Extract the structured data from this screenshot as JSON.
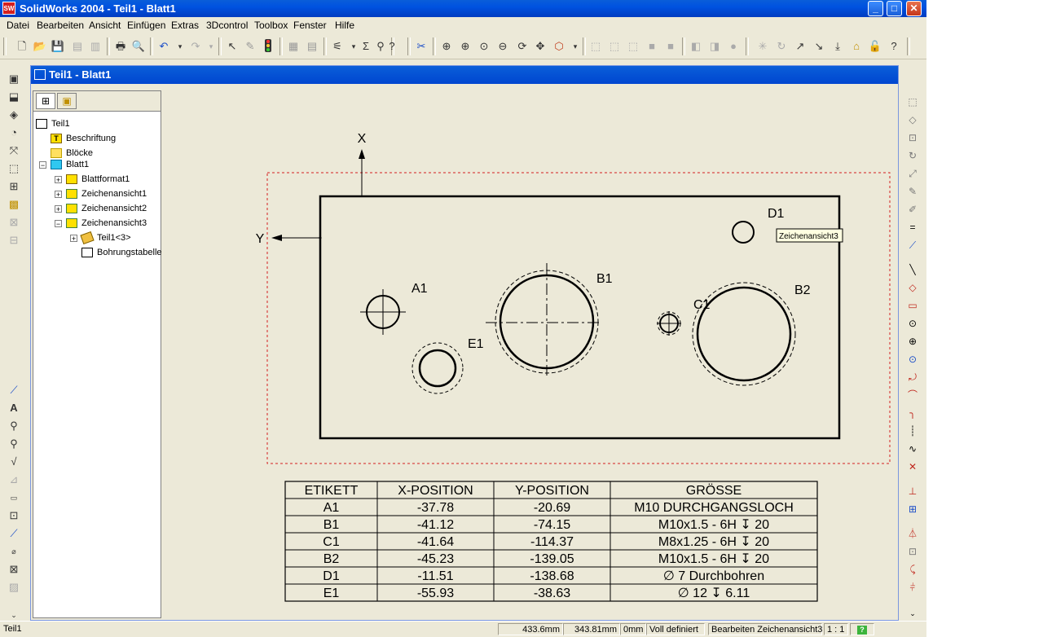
{
  "window": {
    "title": "SolidWorks 2004 - Teil1 - Blatt1",
    "app_icon_text": "SW"
  },
  "menu": [
    "Datei",
    "Bearbeiten",
    "Ansicht",
    "Einfügen",
    "Extras",
    "3Dcontrol",
    "Toolbox",
    "Fenster",
    "Hilfe"
  ],
  "document": {
    "title": "Teil1 - Blatt1"
  },
  "tree": {
    "root": "Teil1",
    "items": [
      "Beschriftung",
      "Blöcke",
      "Blatt1",
      "Blattformat1",
      "Zeichenansicht1",
      "Zeichenansicht2",
      "Zeichenansicht3",
      "Teil1<3>",
      "Bohrungstabelle"
    ]
  },
  "drawing": {
    "axis_x": "X",
    "axis_y": "Y",
    "hole_labels": [
      "A1",
      "B1",
      "C1",
      "B2",
      "D1",
      "E1"
    ],
    "tooltip": "Zeichenansicht3"
  },
  "hole_table": {
    "headers": [
      "ETIKETT",
      "X-POSITION",
      "Y-POSITION",
      "GRÖSSE"
    ],
    "rows": [
      [
        "A1",
        "-37.78",
        "-20.69",
        "M10 DURCHGANGSLOCH"
      ],
      [
        "B1",
        "-41.12",
        "-74.15",
        "M10x1.5 - 6H ↧ 20"
      ],
      [
        "C1",
        "-41.64",
        "-114.37",
        "M8x1.25 - 6H ↧ 20"
      ],
      [
        "B2",
        "-45.23",
        "-139.05",
        "M10x1.5 - 6H ↧ 20"
      ],
      [
        "D1",
        "-11.51",
        "-138.68",
        "∅ 7 Durchbohren"
      ],
      [
        "E1",
        "-55.93",
        "-38.63",
        "∅ 12 ↧ 6.11"
      ]
    ]
  },
  "status": {
    "left": "Teil1",
    "x": "433.6mm",
    "y": "343.81mm",
    "z": "0mm",
    "state": "Voll definiert",
    "mode": "Bearbeiten Zeichenansicht3",
    "scale": "1 : 1",
    "help": "?"
  },
  "colors": {
    "title_blue": "#0052e0",
    "sheet_border_red": "#d42020",
    "bg": "#ece9d8"
  }
}
